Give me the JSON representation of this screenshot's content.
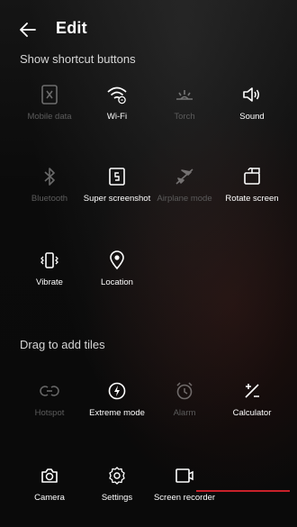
{
  "header": {
    "title": "Edit"
  },
  "sections": {
    "shortcut_title": "Show shortcut buttons",
    "drag_title": "Drag to add tiles"
  },
  "shortcut_tiles": [
    {
      "label": "Mobile data",
      "icon": "mobile-data-icon",
      "enabled": false
    },
    {
      "label": "Wi-Fi",
      "icon": "wifi-icon",
      "enabled": true
    },
    {
      "label": "Torch",
      "icon": "torch-icon",
      "enabled": false
    },
    {
      "label": "Sound",
      "icon": "sound-icon",
      "enabled": true
    },
    {
      "label": "Bluetooth",
      "icon": "bluetooth-icon",
      "enabled": false
    },
    {
      "label": "Super screenshot",
      "icon": "screenshot-icon",
      "enabled": true
    },
    {
      "label": "Airplane mode",
      "icon": "airplane-icon",
      "enabled": false
    },
    {
      "label": "Rotate screen",
      "icon": "rotate-icon",
      "enabled": true
    },
    {
      "label": "Vibrate",
      "icon": "vibrate-icon",
      "enabled": true
    },
    {
      "label": "Location",
      "icon": "location-icon",
      "enabled": true
    }
  ],
  "add_tiles": [
    {
      "label": "Hotspot",
      "icon": "hotspot-icon",
      "enabled": false
    },
    {
      "label": "Extreme mode",
      "icon": "extreme-mode-icon",
      "enabled": true
    },
    {
      "label": "Alarm",
      "icon": "alarm-icon",
      "enabled": false
    },
    {
      "label": "Calculator",
      "icon": "calculator-icon",
      "enabled": true
    },
    {
      "label": "Camera",
      "icon": "camera-icon",
      "enabled": true
    },
    {
      "label": "Settings",
      "icon": "settings-icon",
      "enabled": true
    },
    {
      "label": "Screen recorder",
      "icon": "screen-recorder-icon",
      "enabled": true
    }
  ],
  "colors": {
    "background": "#0b0b0b",
    "text": "#ffffff",
    "dim_text": "#5c5c5c",
    "accent_line": "#c8212a"
  }
}
